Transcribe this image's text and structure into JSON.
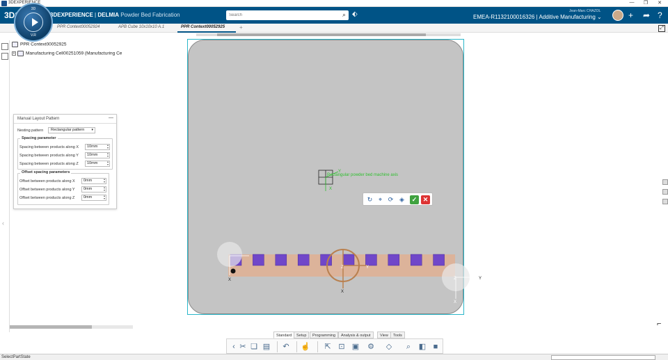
{
  "os_titlebar": {
    "app_name": "3DEXPERIENCE",
    "minimize": "—",
    "restore": "❐",
    "close": "✕"
  },
  "appbar": {
    "ds_logo": "3DS",
    "compass_top": "3D",
    "compass_bottom": "V.R",
    "brand_3dx": "3DEXPERIENCE",
    "brand_sep": " | ",
    "brand_app": "DELMIA",
    "brand_module": " Powder Bed Fabrication",
    "search_placeholder": "Search",
    "user_name": "Jean-Marc CHAZOL",
    "tenant": "EMEA-R1132100016326 | Additive Manufacturing ⌄",
    "add_icon": "+",
    "share_icon": "➦",
    "help_icon": "?"
  },
  "tabs": [
    {
      "label": "PPR Context00052924"
    },
    {
      "label": "APB Cube 10x10x10 A.1"
    },
    {
      "label": "PPR Context00052925"
    }
  ],
  "tab_add": "+",
  "tree": {
    "root": "PPR Context00052925",
    "child": "Manufacturing Cell00251059 (Manufacturing Ce"
  },
  "panel": {
    "title": "Manual Layout Pattern",
    "minimize": "—",
    "nesting_label": "Nesting pattern",
    "nesting_value": "Rectangular pattern",
    "spacing_group": "Spacing parameter",
    "spacing": [
      {
        "label": "Spacing between products along X",
        "value": "10mm"
      },
      {
        "label": "Spacing between products along Y",
        "value": "10mm"
      },
      {
        "label": "Spacing between products along Z",
        "value": "10mm"
      }
    ],
    "offset_group": "Offset spacing parameters",
    "offset": [
      {
        "label": "Offset between products along X",
        "value": "0mm"
      },
      {
        "label": "Offset between products along Y",
        "value": "0mm"
      },
      {
        "label": "Offset between products along Z",
        "value": "0mm"
      }
    ]
  },
  "viewport": {
    "bed_label": "Rectangular powder bed machine axis",
    "axis_x": "X",
    "axis_y": "Y",
    "axis_z": "Z",
    "product_count": 10,
    "colors": {
      "bed": "#c4c4c4",
      "product": "#7047c9",
      "strip": "#dcb39a",
      "robot": "#b9804f",
      "axis_label": "#2fbf2f"
    }
  },
  "bottom_tabs": [
    "Standard",
    "Setup",
    "Programming",
    "Analysis & output",
    "View",
    "Tools"
  ],
  "bottom_toolbar": {
    "icons": [
      "cut-icon",
      "copy-icon",
      "paste-icon",
      "undo-icon",
      "touch-icon",
      "select-icon",
      "fit-all-icon",
      "product-icon",
      "tree-icon",
      "measure-icon",
      "view-icon",
      "cube-icon"
    ]
  },
  "statusbar": {
    "text": "SelectPartState"
  }
}
